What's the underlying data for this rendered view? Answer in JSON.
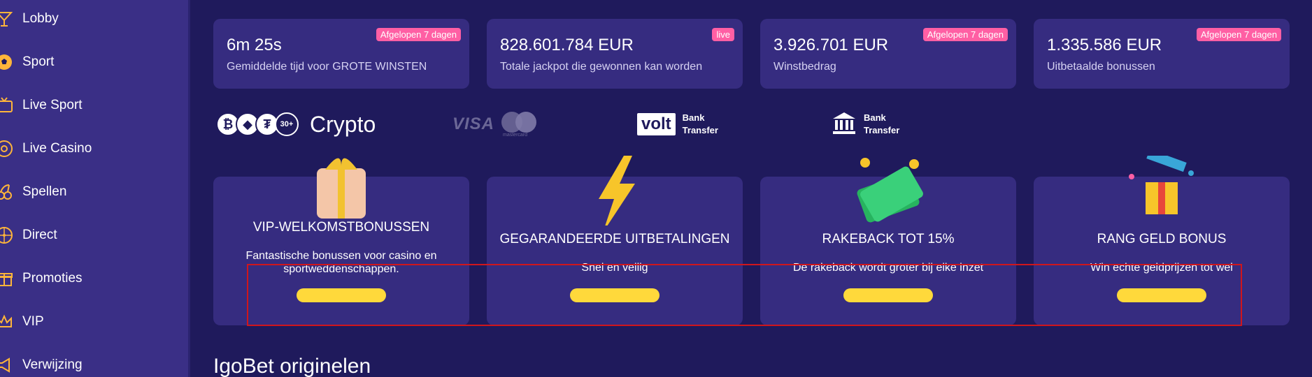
{
  "sidebar": {
    "items": [
      {
        "label": "Lobby",
        "icon": "cocktail-icon"
      },
      {
        "label": "Sport",
        "icon": "soccer-ball-icon"
      },
      {
        "label": "Live Sport",
        "icon": "live-tv-icon"
      },
      {
        "label": "Live Casino",
        "icon": "roulette-icon"
      },
      {
        "label": "Spellen",
        "icon": "cherries-icon"
      },
      {
        "label": "Direct",
        "icon": "roulette-wheel-icon"
      },
      {
        "label": "Promoties",
        "icon": "gift-icon"
      },
      {
        "label": "VIP",
        "icon": "crown-icon"
      },
      {
        "label": "Verwijzing",
        "icon": "megaphone-icon"
      }
    ]
  },
  "stats": [
    {
      "value": "6m 25s",
      "description": "Gemiddelde tijd voor GROTE WINSTEN",
      "badge": "Afgelopen 7 dagen"
    },
    {
      "value": "828.601.784 EUR",
      "description": "Totale jackpot die gewonnen kan worden",
      "badge": "live"
    },
    {
      "value": "3.926.701 EUR",
      "description": "Winstbedrag",
      "badge": "Afgelopen 7 dagen"
    },
    {
      "value": "1.335.586 EUR",
      "description": "Uitbetaalde bonussen",
      "badge": "Afgelopen 7 dagen"
    }
  ],
  "payments": {
    "crypto_count": "30+",
    "crypto_label": "Crypto",
    "visa_label": "VISA",
    "mastercard_label": "mastercard",
    "volt_label": "volt",
    "bank_transfer_line1": "Bank",
    "bank_transfer_line2": "Transfer"
  },
  "features": [
    {
      "title": "VIP-WELKOMSTBONUSSEN",
      "description": "Fantastische bonussen voor casino en sportweddenschappen.",
      "icon": "gift-box-icon"
    },
    {
      "title": "GEGARANDEERDE UITBETALINGEN",
      "description": "Snel en veilig",
      "icon": "lightning-icon"
    },
    {
      "title": "RAKEBACK TOT 15%",
      "description": "De rakeback wordt groter bij elke inzet",
      "icon": "money-stack-icon"
    },
    {
      "title": "RANG GELD BONUS",
      "description": "Win echte geldprijzen tot wel",
      "icon": "open-gift-icon"
    }
  ],
  "section_title": "IgoBet originelen",
  "colors": {
    "background": "#1f1a5c",
    "sidebar": "#3a2f86",
    "card": "#362c80",
    "badge": "#ff5fa4",
    "button": "#ffd93b",
    "highlight": "#d0161c"
  }
}
